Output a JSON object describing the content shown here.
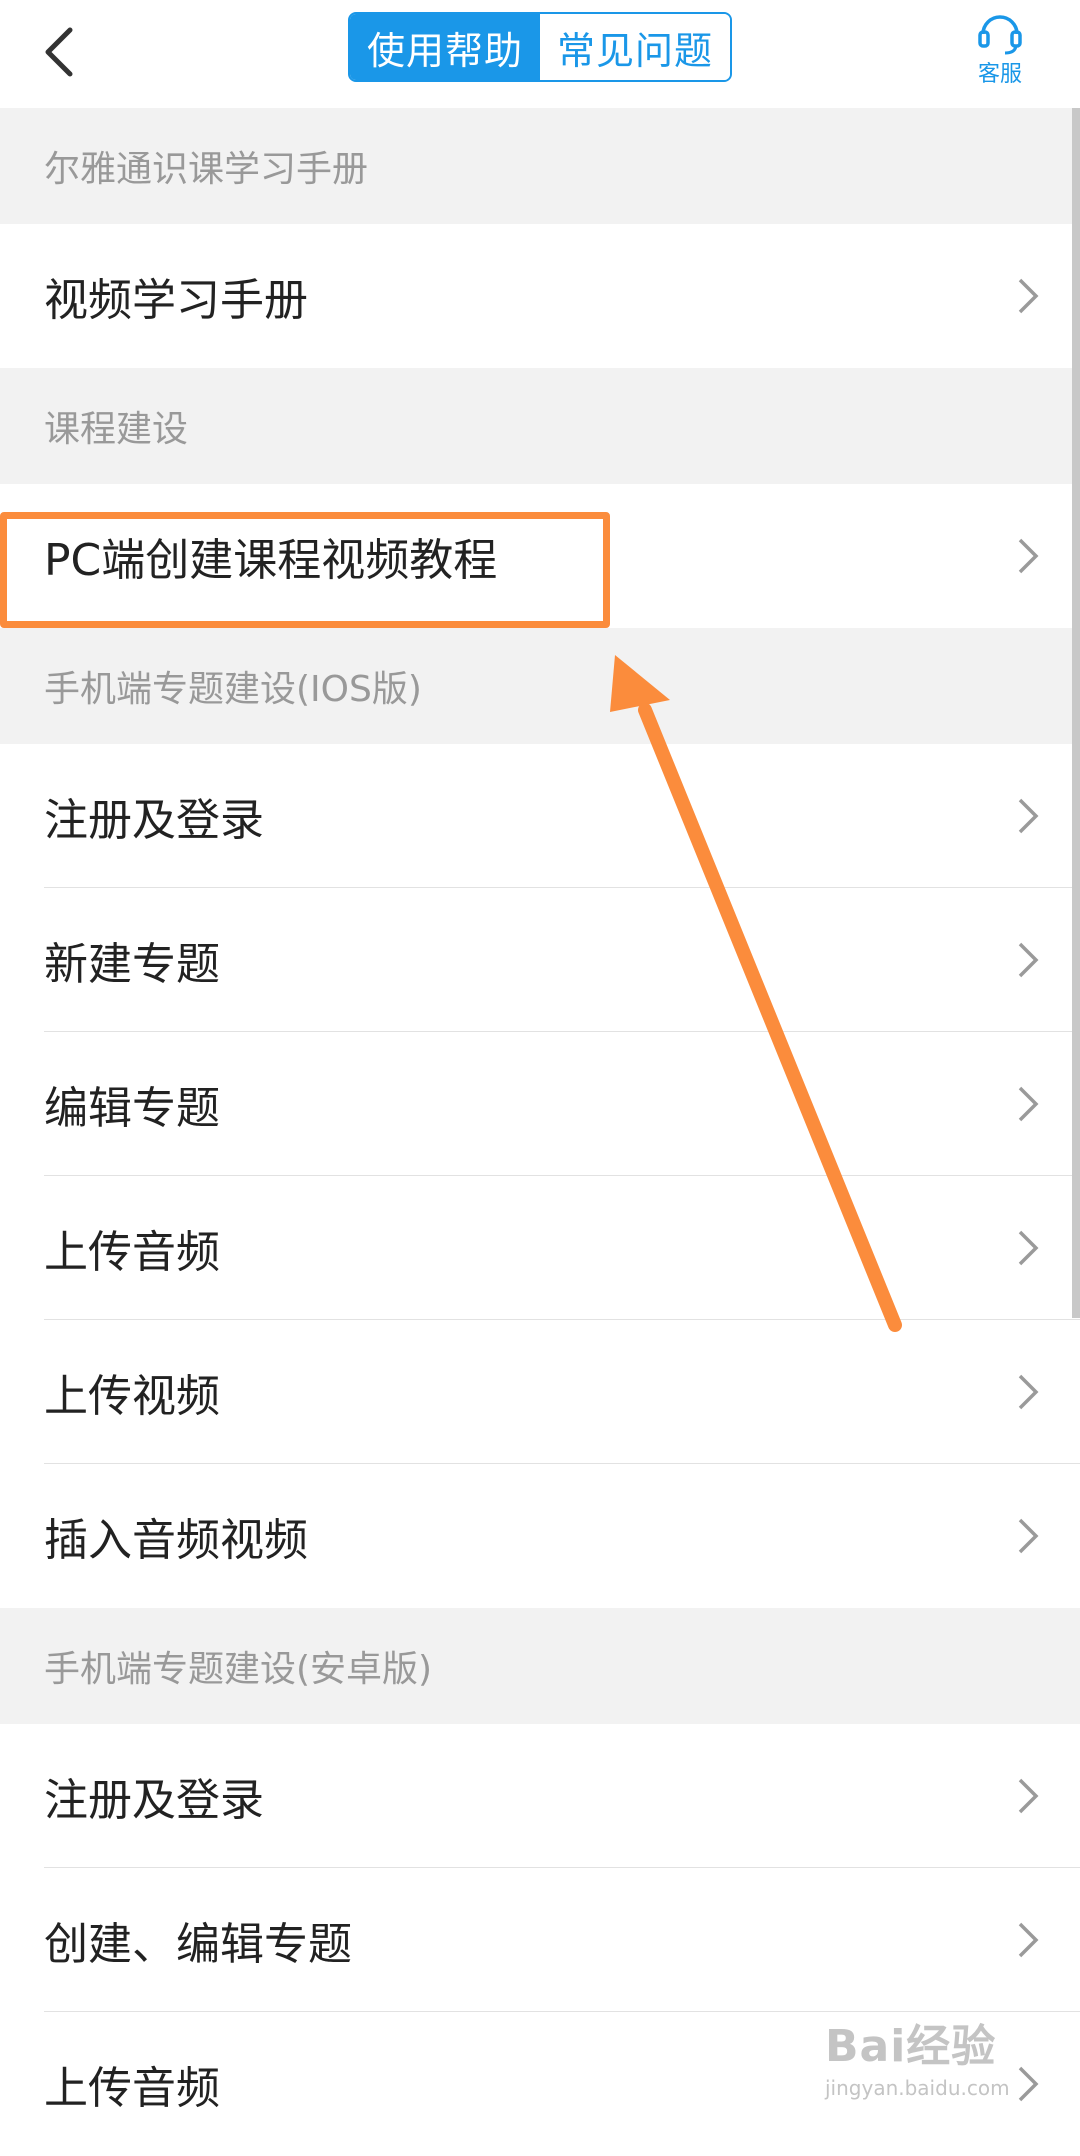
{
  "header": {
    "tab_active": "使用帮助",
    "tab_inactive": "常见问题",
    "service_label": "客服"
  },
  "list": {
    "section1": "尔雅通识课学习手册",
    "s1_items": [
      "视频学习手册"
    ],
    "section2": "课程建设",
    "s2_items": [
      "PC端创建课程视频教程"
    ],
    "section3": "手机端专题建设(IOS版)",
    "s3_items": [
      "注册及登录",
      "新建专题",
      "编辑专题",
      "上传音频",
      "上传视频",
      "插入音频视频"
    ],
    "section4": "手机端专题建设(安卓版)",
    "s4_items": [
      "注册及登录",
      "创建、编辑专题",
      "上传音频"
    ]
  },
  "watermark": {
    "main": "Bai经验",
    "sub": "jingyan.baidu.com"
  },
  "colors": {
    "accent": "#1a97e8",
    "highlight": "#fb8c3c"
  }
}
